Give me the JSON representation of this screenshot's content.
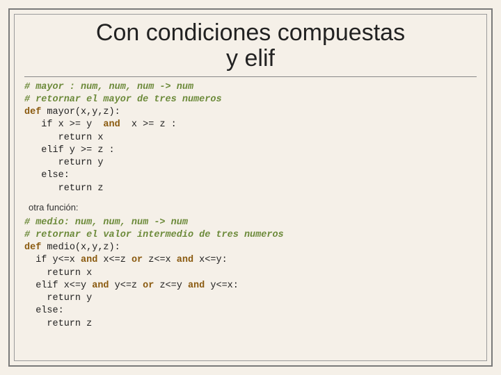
{
  "title_line1": "Con condiciones compuestas",
  "title_line2": "y elif",
  "code1": {
    "l1": "# mayor : num, num, num -> num",
    "l2": "# retornar el mayor de tres numeros",
    "l3a": "def",
    "l3b": " mayor(x,y,z):",
    "l4a": "   if x >= y  ",
    "l4b": "and",
    "l4c": "  x >= z :",
    "l5": "      return x",
    "l6": "   elif y >= z :",
    "l7": "      return y",
    "l8": "   else:",
    "l9": "      return z"
  },
  "caption": "otra función:",
  "code2": {
    "l1": "# medio: num, num, num -> num",
    "l2": "# retornar el valor intermedio de tres numeros",
    "l3a": "def",
    "l3b": " medio(x,y,z):",
    "l4a": "  if y<=x ",
    "l4b": "and",
    "l4c": " x<=z ",
    "l4d": "or",
    "l4e": " z<=x ",
    "l4f": "and",
    "l4g": " x<=y:",
    "l5": "    return x",
    "l6a": "  elif x<=y ",
    "l6b": "and",
    "l6c": " y<=z ",
    "l6d": "or",
    "l6e": " z<=y ",
    "l6f": "and",
    "l6g": " y<=x:",
    "l7": "    return y",
    "l8": "  else:",
    "l9": "    return z"
  }
}
